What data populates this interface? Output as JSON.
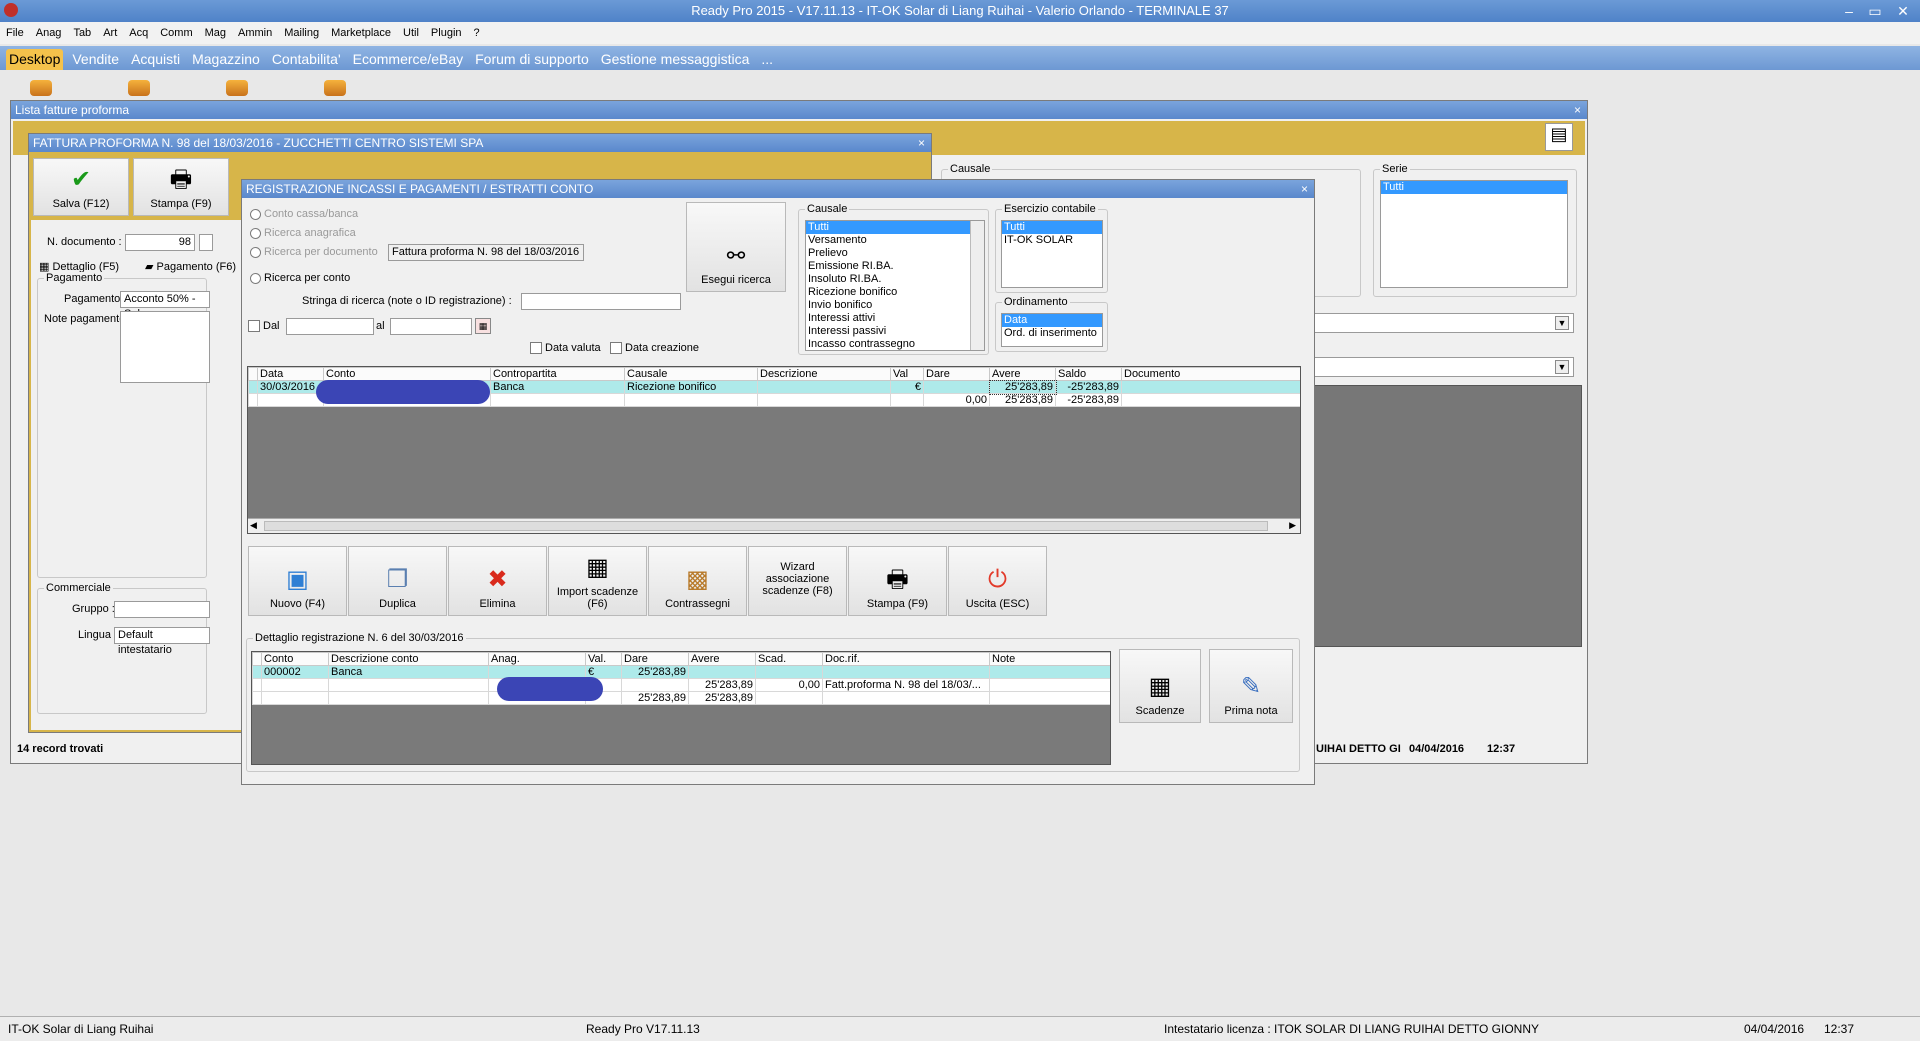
{
  "app": {
    "title": "Ready Pro 2015 - V17.11.13 - IT-OK Solar di Liang Ruihai - Valerio Orlando - TERMINALE 37",
    "window_controls": [
      "–",
      "▭",
      "✕"
    ]
  },
  "menu": [
    "File",
    "Anag",
    "Tab",
    "Art",
    "Acq",
    "Comm",
    "Mag",
    "Ammin",
    "Mailing",
    "Marketplace",
    "Util",
    "Plugin",
    "?"
  ],
  "tabs": [
    "Desktop",
    "Vendite",
    "Acquisti",
    "Magazzino",
    "Contabilita'",
    "Ecommerce/eBay",
    "Forum di supporto",
    "Gestione messaggistica",
    "..."
  ],
  "lista": {
    "title": "Lista fatture proforma",
    "close": "×",
    "causale_label": "Causale",
    "serie_label": "Serie",
    "serie_items": [
      "Tutti"
    ],
    "record_count": "14 record trovati",
    "status_right": "UIHAI DETTO GI",
    "status_date": "04/04/2016",
    "status_time": "12:37"
  },
  "fattura": {
    "title": "FATTURA PROFORMA N. 98 del 18/03/2016 - ZUCCHETTI CENTRO SISTEMI SPA",
    "close": "×",
    "save_label": "Salva (F12)",
    "print_label": "Stampa (F9)",
    "ndoc_label": "N. documento :",
    "ndoc_value": "98",
    "tab_dettaglio": "Dettaglio (F5)",
    "tab_pagamento": "Pagamento (F6)",
    "pagamento_group": "Pagamento",
    "pagamento_label": "Pagamento :",
    "pagamento_value": "Acconto 50% - Sal",
    "note_label": "Note pagamento :",
    "commerciale_group": "Commerciale",
    "gruppo_label": "Gruppo :",
    "lingua_label": "Lingua :",
    "lingua_value": "Default intestatario"
  },
  "reg": {
    "title": "REGISTRAZIONE INCASSI E PAGAMENTI / ESTRATTI CONTO",
    "close": "×",
    "opt_conto_cassa": "Conto cassa/banca",
    "opt_ricerca_anagrafica": "Ricerca anagrafica",
    "opt_ricerca_documento": "Ricerca per documento",
    "documento_value": "Fattura proforma N. 98 del 18/03/2016",
    "opt_ricerca_conto": "Ricerca per conto",
    "stringa_label": "Stringa di ricerca (note o ID registrazione) :",
    "dal_label": "Dal",
    "al_label": "al",
    "data_valuta": "Data valuta",
    "data_creazione": "Data creazione",
    "esegui_label": "Esegui ricerca",
    "causale_group": "Causale",
    "causale_items": [
      "Tutti",
      "Versamento",
      "Prelievo",
      "Emissione RI.BA.",
      "Insoluto RI.BA.",
      "Ricezione bonifico",
      "Invio bonifico",
      "Interessi attivi",
      "Interessi passivi",
      "Incasso contrassegno"
    ],
    "esercizio_group": "Esercizio contabile",
    "esercizio_items": [
      "Tutti",
      "IT-OK SOLAR"
    ],
    "ordinamento_group": "Ordinamento",
    "ordinamento_items": [
      "Data",
      "Ord. di inserimento"
    ],
    "grid_headers": [
      "Data",
      "Conto",
      "Contropartita",
      "Causale",
      "Descrizione",
      "Val",
      "Dare",
      "Avere",
      "Saldo",
      "Documento"
    ],
    "grid_rows": [
      [
        "30/03/2016",
        "",
        "Banca",
        "Ricezione bonifico",
        "",
        "€",
        "",
        "25'283,89",
        "-25'283,89",
        ""
      ],
      [
        "",
        "",
        "",
        "",
        "",
        "",
        "0,00",
        "25'283,89",
        "-25'283,89",
        ""
      ]
    ],
    "buttons": [
      "Nuovo (F4)",
      "Duplica",
      "Elimina",
      "Import scadenze (F6)",
      "Contrassegni",
      "Wizard associazione scadenze (F8)",
      "Stampa (F9)",
      "Uscita (ESC)"
    ],
    "detail_group": "Dettaglio registrazione N. 6 del 30/03/2016",
    "detail_headers": [
      "Conto",
      "Descrizione conto",
      "Anag.",
      "Val.",
      "Dare",
      "Avere",
      "Scad.",
      "Doc.rif.",
      "Note"
    ],
    "detail_rows": [
      [
        "000002",
        "Banca",
        "",
        "€",
        "25'283,89",
        "",
        "",
        "",
        ""
      ],
      [
        "",
        "",
        "",
        "€",
        "",
        "25'283,89",
        "0,00",
        "Fatt.proforma N. 98 del 18/03/...",
        ""
      ],
      [
        "",
        "",
        "",
        "",
        "25'283,89",
        "25'283,89",
        "",
        "",
        ""
      ]
    ],
    "scadenze_label": "Scadenze",
    "prima_nota_label": "Prima nota"
  },
  "statusbar": {
    "company": "IT-OK Solar di Liang Ruihai",
    "version": "Ready Pro V17.11.13",
    "license": "Intestatario licenza : ITOK SOLAR DI LIANG RUIHAI DETTO GIONNY",
    "date": "04/04/2016",
    "time": "12:37"
  },
  "colors": {
    "accent_title": "#5a88cc",
    "row_highlight": "#aeeaea",
    "selection": "#3399ff",
    "active_tab": "#f4c24b",
    "form_gold": "#d7b549"
  }
}
